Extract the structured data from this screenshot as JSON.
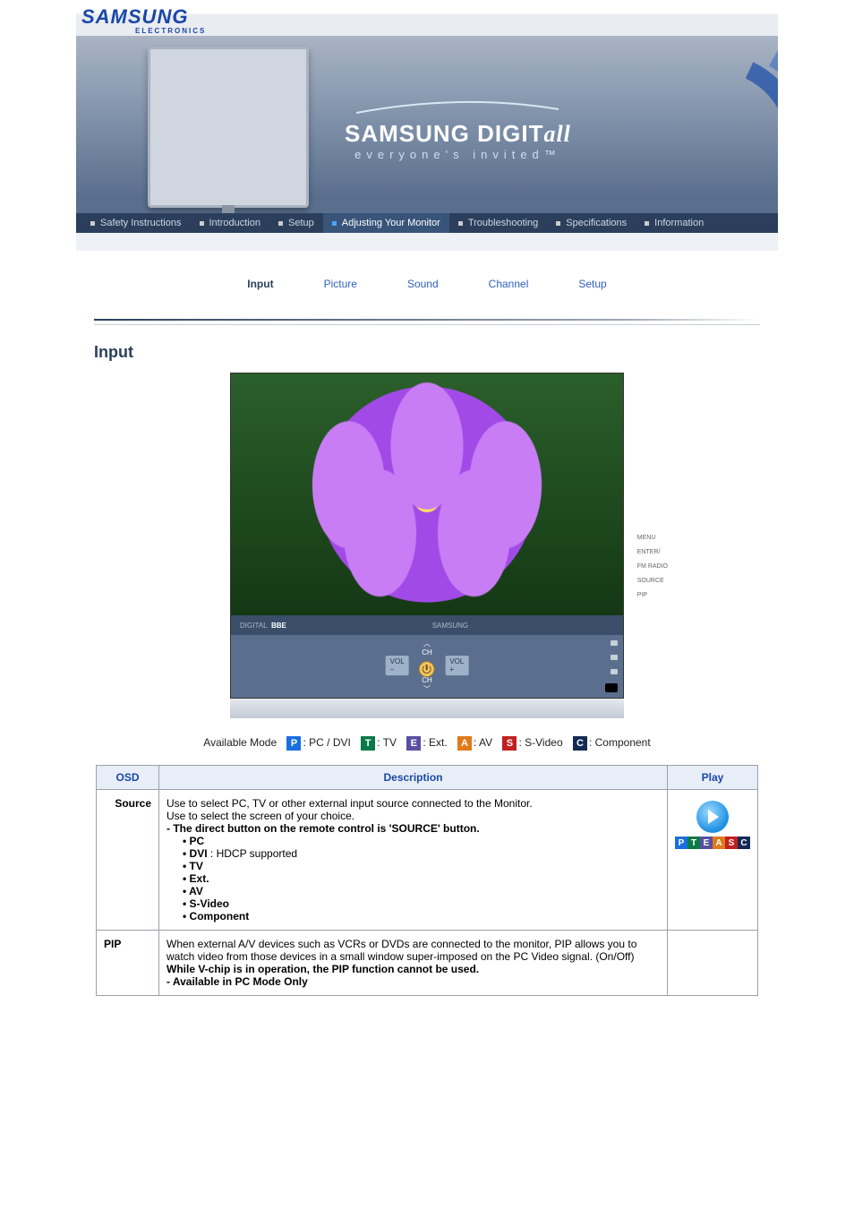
{
  "brand": {
    "logo": "SAMSUNG",
    "sub": "ELECTRONICS"
  },
  "tagline": {
    "brand_head": "SAMSUNG DIGIT",
    "brand_tail": "all",
    "sub": "everyone's   invited™"
  },
  "main_nav": [
    {
      "label": "Safety Instructions",
      "active": false
    },
    {
      "label": "Introduction",
      "active": false
    },
    {
      "label": "Setup",
      "active": false
    },
    {
      "label": "Adjusting Your Monitor",
      "active": true
    },
    {
      "label": "Troubleshooting",
      "active": false
    },
    {
      "label": "Specifications",
      "active": false
    },
    {
      "label": "Information",
      "active": false
    }
  ],
  "sub_nav": [
    {
      "label": "Input",
      "active": true
    },
    {
      "label": "Picture",
      "active": false
    },
    {
      "label": "Sound",
      "active": false
    },
    {
      "label": "Channel",
      "active": false
    },
    {
      "label": "Setup",
      "active": false
    }
  ],
  "section_title": "Input",
  "osd_figure": {
    "panel_left_1": "DIGITAL",
    "panel_left_2": "BBE",
    "panel_center": "SAMSUNG",
    "ctrl": {
      "ch_up": "CH",
      "ch_dn": "CH",
      "vol_minus": "VOL\n−",
      "vol_plus": "VOL\n+"
    },
    "side_labels": [
      "MENU",
      "ENTER/\nFM RADIO",
      "SOURCE",
      "PIP"
    ]
  },
  "legend": {
    "title": "Available Mode",
    "items": [
      {
        "chip": "P",
        "cls": "cP",
        "label": ": PC / DVI"
      },
      {
        "chip": "T",
        "cls": "cT",
        "label": ": TV"
      },
      {
        "chip": "E",
        "cls": "cE",
        "label": ": Ext."
      },
      {
        "chip": "A",
        "cls": "cA",
        "label": ": AV"
      },
      {
        "chip": "S",
        "cls": "cS",
        "label": ": S-Video"
      },
      {
        "chip": "C",
        "cls": "cC",
        "label": ": Component"
      }
    ]
  },
  "table": {
    "headers": {
      "osd": "OSD",
      "desc": "Description",
      "play": "Play"
    },
    "rows": [
      {
        "osd": "Source",
        "desc_lines": [
          "Use to select PC, TV or other external input source connected to the Monitor.",
          "Use to select the screen of your choice."
        ],
        "desc_bold": "- The direct button on the remote control is 'SOURCE' button.",
        "bullets": [
          "PC",
          "DVI : HDCP supported",
          "TV",
          "Ext.",
          "AV",
          "S-Video",
          "Component"
        ],
        "dvi_prefix": "DVI",
        "dvi_suffix": " : HDCP supported",
        "play_chips": [
          "P",
          "T",
          "E",
          "A",
          "S",
          "C"
        ],
        "play": true
      },
      {
        "osd": "PIP",
        "desc_lines": [
          "When external A/V devices such as VCRs or DVDs are connected to the monitor, PIP allows you to watch video from those devices in a small window super-imposed on the PC Video signal. (On/Off)"
        ],
        "desc_bold": "While V-chip is in operation, the PIP function cannot be used.",
        "desc_bold2": "- Available in PC Mode Only",
        "play": false
      }
    ]
  }
}
